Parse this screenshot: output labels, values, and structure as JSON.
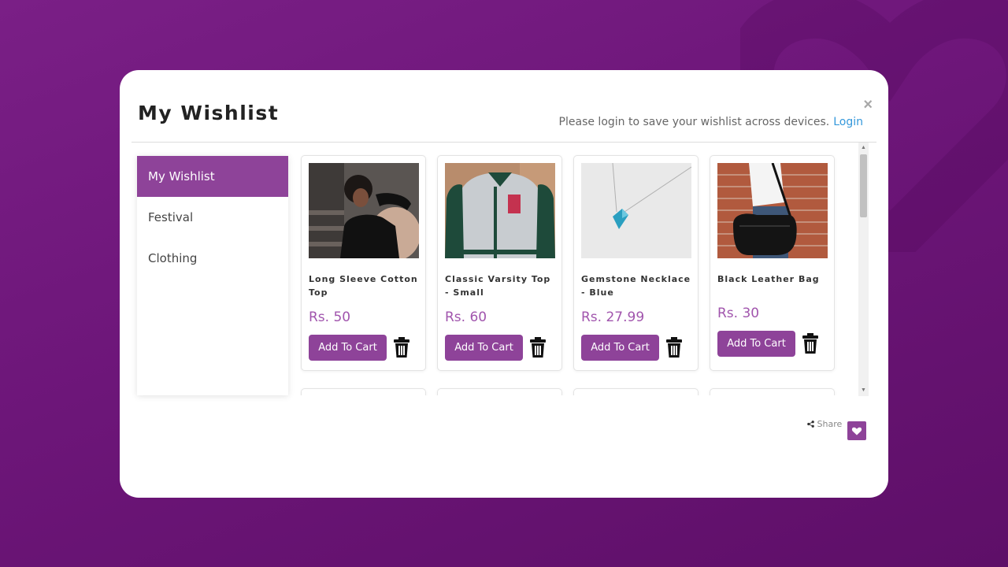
{
  "modal": {
    "title": "My Wishlist",
    "close_icon": "×",
    "login_prompt": "Please login to save your wishlist across devices.",
    "login_link": "Login"
  },
  "sidebar": {
    "items": [
      {
        "label": "My Wishlist",
        "active": true
      },
      {
        "label": "Festival",
        "active": false
      },
      {
        "label": "Clothing",
        "active": false
      }
    ]
  },
  "products": [
    {
      "name": "Long Sleeve Cotton Top",
      "price": "Rs. 50",
      "button": "Add To Cart",
      "image": "woman-black-top-photo"
    },
    {
      "name": "Classic Varsity Top - Small",
      "price": "Rs. 60",
      "button": "Add To Cart",
      "image": "varsity-jacket-photo"
    },
    {
      "name": "Gemstone Necklace - Blue",
      "price": "Rs. 27.99",
      "button": "Add To Cart",
      "image": "blue-necklace-photo"
    },
    {
      "name": "Black Leather Bag",
      "price": "Rs. 30",
      "button": "Add To Cart",
      "image": "black-bag-photo"
    }
  ],
  "footer": {
    "share_label": "Share",
    "share_icon": "share-icon",
    "wishlist_icon": "heart-icon"
  },
  "colors": {
    "accent": "#8e4399",
    "price": "#a155ad",
    "login_link": "#3498db",
    "background": "#6d1679"
  }
}
